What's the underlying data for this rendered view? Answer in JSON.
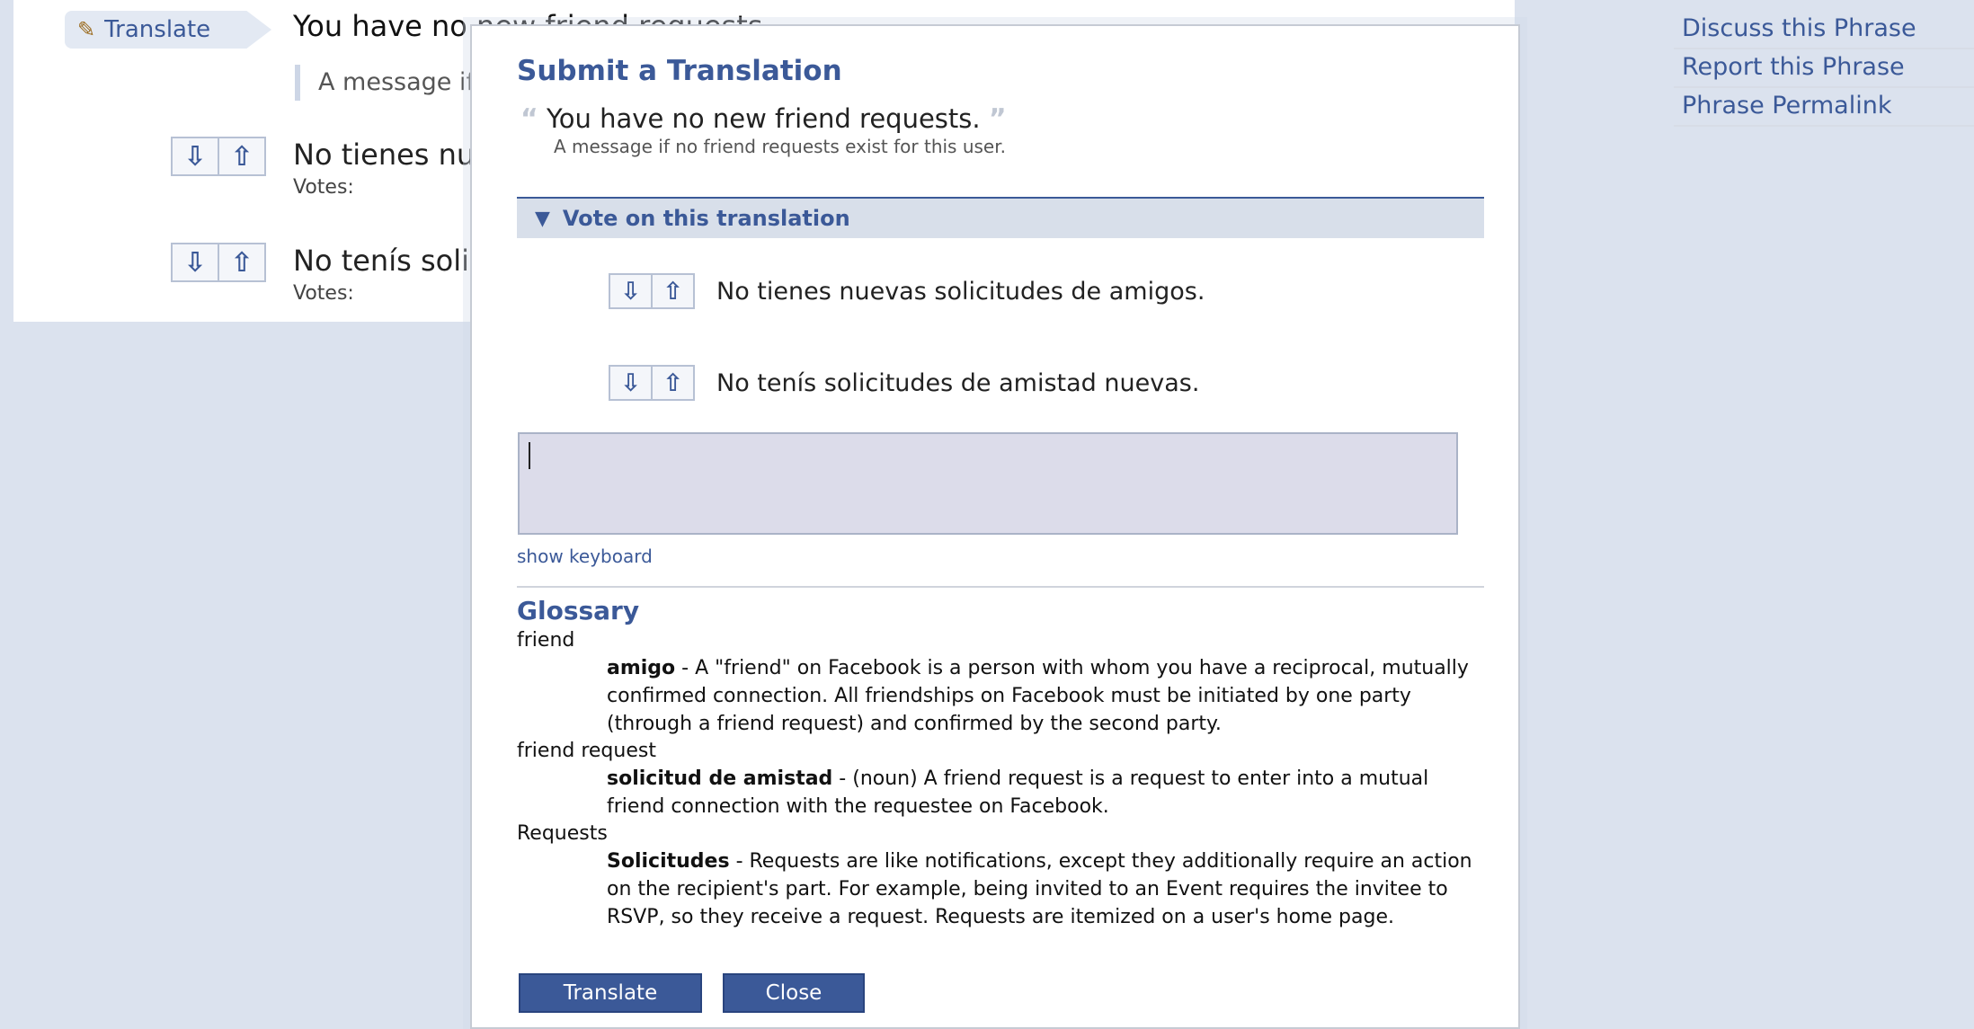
{
  "background": {
    "translate_tab_label": "Translate",
    "phrase": "You have no new friend requests.",
    "phrase_description": "A message if no friend requests exist for this user.",
    "votes_label": "Votes:",
    "translations": [
      {
        "text": "No tienes nuevas solicitudes de amigos."
      },
      {
        "text": "No tenís solicitudes de amistad nuevas."
      }
    ],
    "side_links": [
      "Discuss this Phrase",
      "Report this Phrase",
      "Phrase Permalink"
    ]
  },
  "dialog": {
    "title": "Submit a Translation",
    "quote_open": "“",
    "quote_close": "”",
    "phrase": "You have no new friend requests.",
    "phrase_description": "A message if no friend requests exist for this user.",
    "vote_section_label": "Vote on this translation",
    "vote_items": [
      "No tienes nuevas solicitudes de amigos.",
      "No tenís solicitudes de amistad nuevas."
    ],
    "input_value": "",
    "show_keyboard": "show keyboard",
    "glossary_title": "Glossary",
    "glossary": [
      {
        "term": "friend",
        "translation": "amigo",
        "definition": " - A \"friend\" on Facebook is a person with whom you have a reciprocal, mutually confirmed connection. All friendships on Facebook must be initiated by one party (through a friend request) and confirmed by the second party."
      },
      {
        "term": "friend request",
        "translation": "solicitud de amistad",
        "definition": " - (noun) A friend request is a request to enter into a mutual friend connection with the requestee on Facebook."
      },
      {
        "term": "Requests",
        "translation": "Solicitudes",
        "definition": " - Requests are like notifications, except they additionally require an action on the recipient's part. For example, being invited to an Event requires the invitee to RSVP, so they receive a request. Requests are itemized on a user's home page."
      }
    ],
    "translate_button": "Translate",
    "close_button": "Close"
  },
  "icons": {
    "pencil": "✎",
    "down_arrow": "⇩",
    "up_arrow": "⇧",
    "triangle_down": "▼"
  },
  "colors": {
    "brand": "#3b5998",
    "background": "#dbe2ee",
    "input_bg": "#dcdcea"
  }
}
